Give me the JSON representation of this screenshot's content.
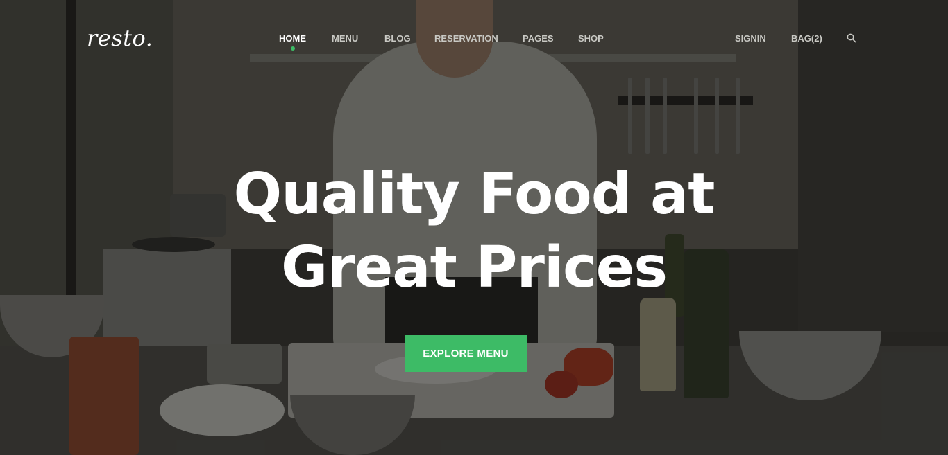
{
  "brand": {
    "logo_text": "resto."
  },
  "nav": {
    "items": [
      {
        "label": "HOME",
        "active": true
      },
      {
        "label": "MENU",
        "active": false
      },
      {
        "label": "BLOG",
        "active": false
      },
      {
        "label": "RESERVATION",
        "active": false
      },
      {
        "label": "PAGES",
        "active": false
      },
      {
        "label": "SHOP",
        "active": false
      }
    ],
    "signin_label": "SIGNIN",
    "bag_label": "BAG(2)",
    "search_icon": "search-icon"
  },
  "hero": {
    "headline_line1": "Quality Food at",
    "headline_line2": "Great Prices",
    "cta_label": "EXPLORE MENU"
  },
  "colors": {
    "accent": "#3dbb66",
    "text_primary": "#ffffff",
    "nav_text": "#c9c9c4"
  }
}
